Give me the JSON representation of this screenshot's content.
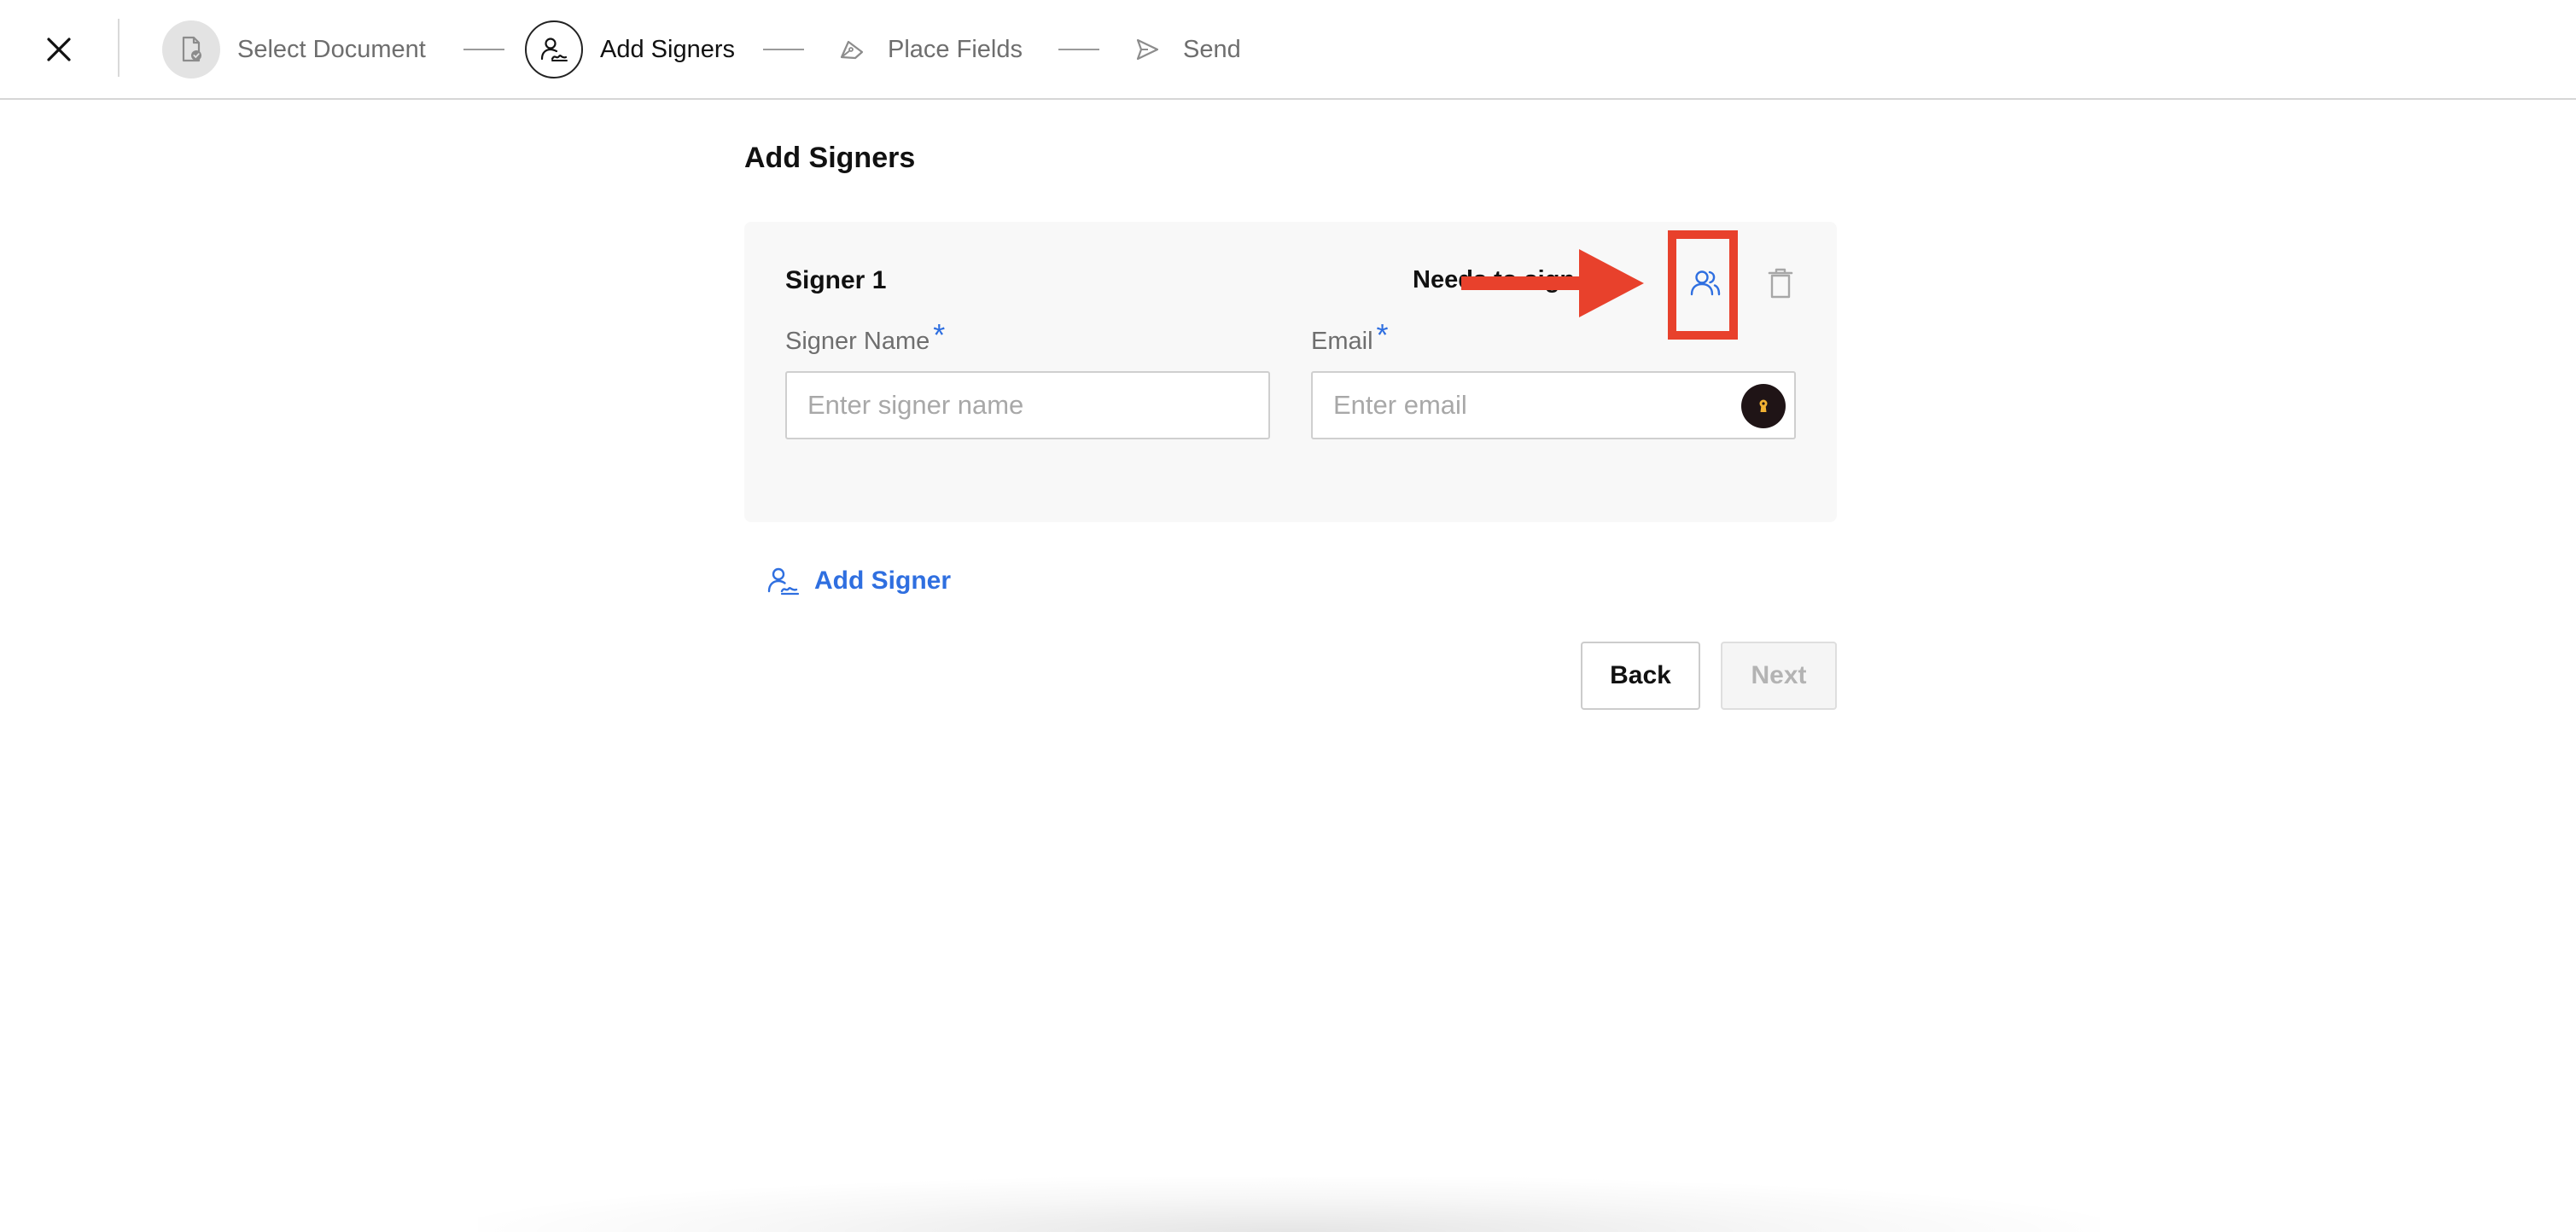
{
  "header": {
    "close_icon": "close-icon",
    "steps": [
      {
        "label": "Select Document",
        "icon": "document-check-icon",
        "state": "done"
      },
      {
        "label": "Add Signers",
        "icon": "signer-icon",
        "state": "active"
      },
      {
        "label": "Place Fields",
        "icon": "pen-nib-icon",
        "state": "upcoming"
      },
      {
        "label": "Send",
        "icon": "send-icon",
        "state": "upcoming"
      }
    ]
  },
  "main": {
    "title": "Add Signers",
    "signers": [
      {
        "title": "Signer 1",
        "role": "Needs to sign",
        "contacts_icon": "contacts-icon",
        "delete_icon": "trash-icon",
        "name_field": {
          "label": "Signer Name",
          "required_mark": "*",
          "placeholder": "Enter signer name",
          "value": ""
        },
        "email_field": {
          "label": "Email",
          "required_mark": "*",
          "placeholder": "Enter email",
          "value": "",
          "autofill_icon": "password-manager-icon"
        }
      }
    ],
    "add_signer_label": "Add Signer",
    "back_label": "Back",
    "next_label": "Next"
  },
  "annotation": {
    "color": "#e8412c",
    "target": "contacts-icon"
  },
  "colors": {
    "accent": "#2f6fe0",
    "annotation_red": "#e8412c",
    "text_primary": "#111111",
    "text_muted": "#6e6e6e",
    "card_bg": "#f8f8f8"
  }
}
